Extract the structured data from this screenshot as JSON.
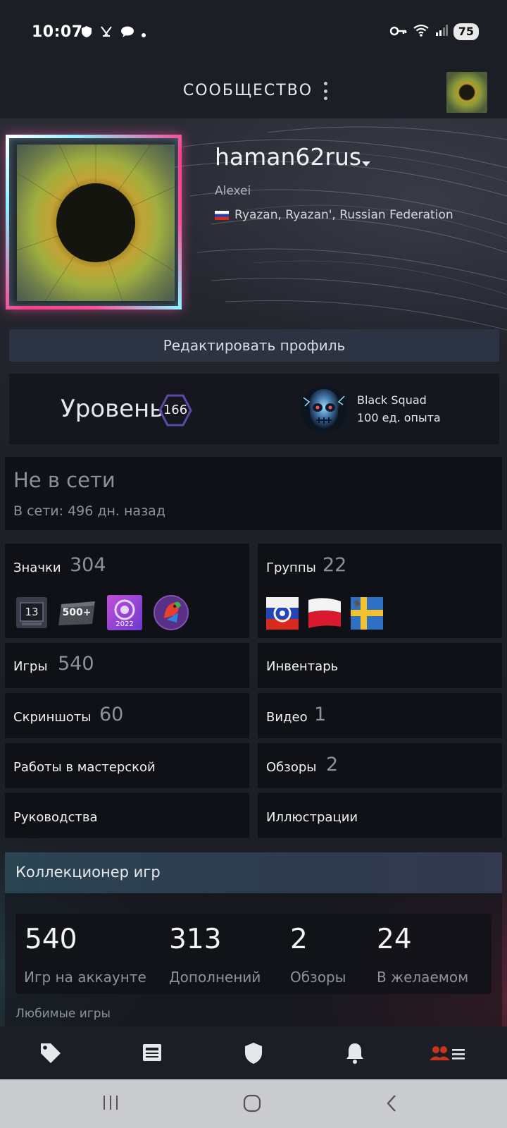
{
  "status_bar": {
    "time": "10:07",
    "battery": "75"
  },
  "header": {
    "title": "СООБЩЕСТВО"
  },
  "profile": {
    "username": "haman62rus",
    "real_name": "Alexei",
    "location": "Ryazan, Ryazan', Russian Federation",
    "edit_label": "Редактировать профиль"
  },
  "level": {
    "label": "Уровень",
    "value": "166",
    "badge_name": "Black Squad",
    "badge_xp": "100 ед. опыта"
  },
  "status": {
    "title": "Не в сети",
    "last_online": "В сети: 496 дн. назад"
  },
  "grid": {
    "badges_label": "Значки",
    "badges_count": "304",
    "badge_thumbs": [
      "13",
      "500+",
      "2022"
    ],
    "groups_label": "Группы",
    "groups_count": "22",
    "games_label": "Игры",
    "games_count": "540",
    "inventory_label": "Инвентарь",
    "screenshots_label": "Скриншоты",
    "screenshots_count": "60",
    "videos_label": "Видео",
    "videos_count": "1",
    "workshop_label": "Работы в мастерской",
    "reviews_label": "Обзоры",
    "reviews_count": "2",
    "guides_label": "Руководства",
    "artwork_label": "Иллюстрации"
  },
  "collector": {
    "title": "Коллекционер игр",
    "stats": [
      {
        "value": "540",
        "label": "Игр на аккаунте"
      },
      {
        "value": "313",
        "label": "Дополнений"
      },
      {
        "value": "2",
        "label": "Обзоры"
      },
      {
        "value": "24",
        "label": "В желаемом"
      }
    ],
    "favorites_label": "Любимые игры"
  },
  "bottom_nav": {
    "items": [
      "tag-icon",
      "news-icon",
      "shield-icon",
      "bell-icon",
      "community-menu-icon"
    ],
    "active_color": "#c8341c"
  },
  "colors": {
    "accent_level": "#5b4aa8",
    "edit_button": "#2c3444"
  }
}
